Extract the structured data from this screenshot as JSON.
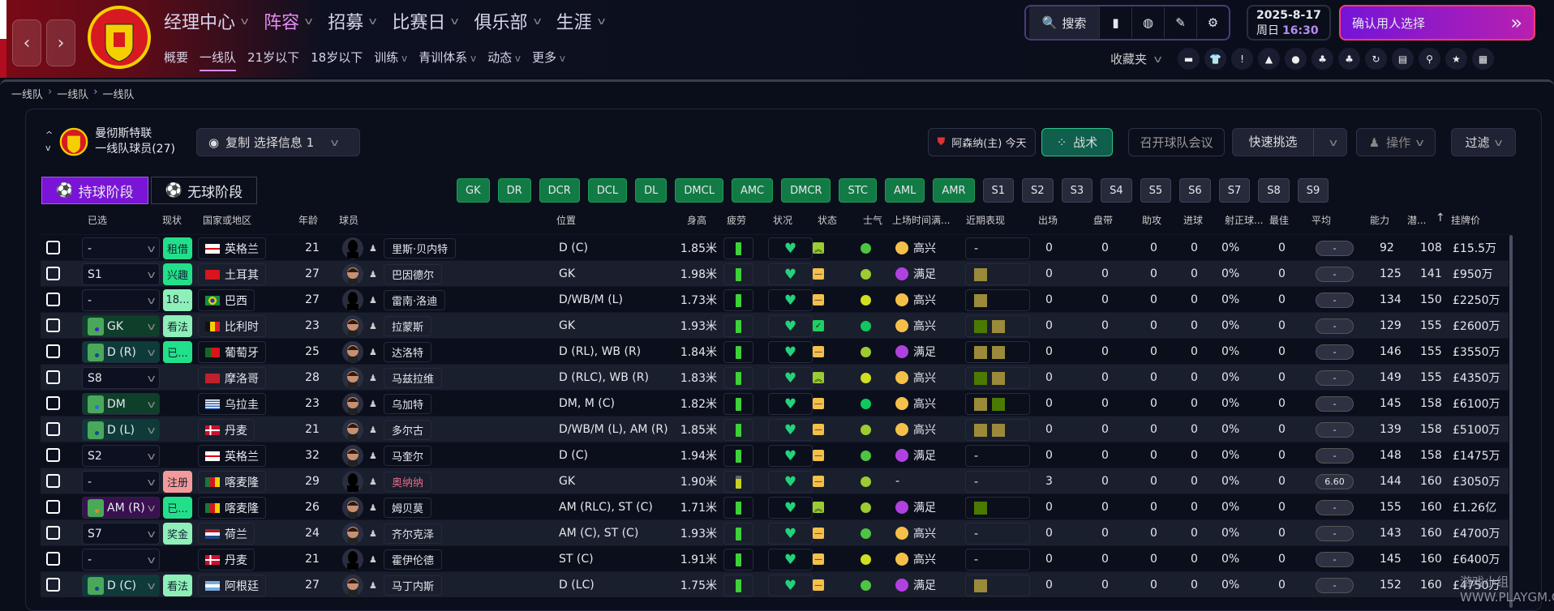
{
  "header": {
    "nav": [
      "经理中心",
      "阵容",
      "招募",
      "比赛日",
      "俱乐部",
      "生涯"
    ],
    "nav_active": 1,
    "subnav": [
      "概要",
      "一线队",
      "21岁以下",
      "18岁以下",
      "训练",
      "青训体系",
      "动态",
      "更多"
    ],
    "subnav_dropdown": [
      4,
      5,
      6,
      7
    ],
    "subnav_active": 1,
    "search": "搜索",
    "date": "2025-8-17",
    "weekday": "周日",
    "time": "16:30",
    "confirm": "确认用人选择",
    "favorites": "收藏夹",
    "toolbar_icons": [
      "chat-icon",
      "shirt-icon",
      "alert-icon",
      "cone-icon",
      "ball-icon",
      "staff-icon",
      "staff-star-icon",
      "refresh-icon",
      "report-icon",
      "scout-icon",
      "star-search-icon",
      "calendar-icon"
    ],
    "accent": "#b68cf0"
  },
  "breadcrumb": [
    "一线队",
    "一线队",
    "一线队"
  ],
  "team": {
    "name": "曼彻斯特联",
    "squad": "一线队球员(27)",
    "copy": "复制 选择信息 1",
    "opponent": "阿森纳(主) 今天",
    "tactics": "战术",
    "meeting": "召开球队会议",
    "quick": "快速挑选",
    "ops": "操作",
    "filter": "过滤"
  },
  "phases": [
    "持球阶段",
    "无球阶段"
  ],
  "positions": [
    "GK",
    "DR",
    "DCR",
    "DCL",
    "DL",
    "DMCL",
    "AMC",
    "DMCR",
    "STC",
    "AML",
    "AMR"
  ],
  "slots": [
    "S1",
    "S2",
    "S3",
    "S4",
    "S5",
    "S6",
    "S7",
    "S8",
    "S9"
  ],
  "columns": [
    "已选",
    "现状",
    "国家或地区",
    "年龄",
    "球员",
    "位置",
    "身高",
    "疲劳",
    "状况",
    "状态",
    "士气",
    "上场时间满...",
    "近期表现",
    "出场",
    "盘带",
    "助攻",
    "进球",
    "射正球...",
    "最佳",
    "平均",
    "能力",
    "潜...",
    "挂牌价"
  ],
  "sort_column": "潜...",
  "players": [
    {
      "sel": "-",
      "pitch": "",
      "badge": "租借",
      "bc": "#22e08a",
      "nat": "英格兰",
      "flag": "eng",
      "age": "21",
      "face": false,
      "name": "里斯·贝内特",
      "pos": "D (C)",
      "h": "1.85米",
      "fat": "full",
      "state": "up",
      "mor": "#4cc640",
      "mood": "高兴",
      "mc": "#f5c04a",
      "form": [],
      "apps": "0",
      "drb": "0",
      "ast": "0",
      "gls": "0",
      "sot": "0%",
      "pom": "0",
      "avg": "-",
      "ca": "92",
      "pa": "108",
      "price": "£15.5万"
    },
    {
      "sel": "S1",
      "pitch": "",
      "badge": "兴趣",
      "bc": "#22e08a",
      "nat": "土耳其",
      "flag": "tur",
      "age": "27",
      "face": true,
      "name": "巴因德尔",
      "pos": "GK",
      "h": "1.98米",
      "fat": "full",
      "state": "mid",
      "mor": "#9ccc30",
      "mood": "满足",
      "mc": "#b040e0",
      "form": [
        "o"
      ],
      "apps": "0",
      "drb": "0",
      "ast": "0",
      "gls": "0",
      "sot": "0%",
      "pom": "0",
      "avg": "-",
      "ca": "125",
      "pa": "141",
      "price": "£950万"
    },
    {
      "sel": "-",
      "pitch": "",
      "badge": "18...",
      "bc": "#8ef0b8",
      "nat": "巴西",
      "flag": "bra",
      "age": "27",
      "face": false,
      "name": "雷南·洛迪",
      "pos": "D/WB/M (L)",
      "h": "1.73米",
      "fat": "full",
      "state": "mid",
      "mor": "#d0e020",
      "mood": "高兴",
      "mc": "#f5c04a",
      "form": [
        "o"
      ],
      "apps": "0",
      "drb": "0",
      "ast": "0",
      "gls": "0",
      "sot": "0%",
      "pom": "0",
      "avg": "-",
      "ca": "134",
      "pa": "150",
      "price": "£2250万"
    },
    {
      "sel": "GK",
      "pitch": "green",
      "dot": "#4a20d0",
      "badge": "看法",
      "bc": "#8ef0b8",
      "nat": "比利时",
      "flag": "bel",
      "age": "23",
      "face": true,
      "name": "拉蒙斯",
      "pos": "GK",
      "h": "1.93米",
      "fat": "full",
      "state": "ok",
      "mor": "#10c860",
      "mood": "高兴",
      "mc": "#f5c04a",
      "form": [
        "g",
        "o"
      ],
      "apps": "0",
      "drb": "0",
      "ast": "0",
      "gls": "0",
      "sot": "0%",
      "pom": "0",
      "avg": "-",
      "ca": "129",
      "pa": "155",
      "price": "£2600万"
    },
    {
      "sel": "D (R)",
      "pitch": "teal",
      "dot": "#104a90",
      "badge": "已...",
      "bc": "#22e08a",
      "nat": "葡萄牙",
      "flag": "por",
      "age": "25",
      "face": true,
      "name": "达洛特",
      "pos": "D (RL), WB (R)",
      "h": "1.84米",
      "fat": "full",
      "state": "mid",
      "mor": "#9ccc30",
      "mood": "满足",
      "mc": "#b040e0",
      "form": [
        "o",
        "o"
      ],
      "apps": "0",
      "drb": "0",
      "ast": "0",
      "gls": "0",
      "sot": "0%",
      "pom": "0",
      "avg": "-",
      "ca": "146",
      "pa": "155",
      "price": "£3550万"
    },
    {
      "sel": "S8",
      "pitch": "",
      "badge": "",
      "nat": "摩洛哥",
      "flag": "mar",
      "age": "28",
      "face": true,
      "name": "马兹拉维",
      "pos": "D (RLC), WB (R)",
      "h": "1.83米",
      "fat": "full",
      "state": "up",
      "mor": "#d0e020",
      "mood": "高兴",
      "mc": "#f5c04a",
      "form": [
        "g",
        "o"
      ],
      "apps": "0",
      "drb": "0",
      "ast": "0",
      "gls": "0",
      "sot": "0%",
      "pom": "0",
      "avg": "-",
      "ca": "149",
      "pa": "155",
      "price": "£4350万"
    },
    {
      "sel": "DM",
      "pitch": "green",
      "dot": "#2a70e0",
      "badge": "",
      "nat": "乌拉圭",
      "flag": "uru",
      "age": "23",
      "face": true,
      "name": "乌加特",
      "pos": "DM, M (C)",
      "h": "1.82米",
      "fat": "full",
      "state": "mid",
      "mor": "#10c860",
      "mood": "高兴",
      "mc": "#f5c04a",
      "form": [
        "o",
        "g"
      ],
      "apps": "0",
      "drb": "0",
      "ast": "0",
      "gls": "0",
      "sot": "0%",
      "pom": "0",
      "avg": "-",
      "ca": "145",
      "pa": "158",
      "price": "£6100万"
    },
    {
      "sel": "D (L)",
      "pitch": "teal",
      "dot": "#104a90",
      "badge": "",
      "nat": "丹麦",
      "flag": "den",
      "age": "21",
      "face": true,
      "name": "多尔古",
      "pos": "D/WB/M (L), AM (R)",
      "h": "1.85米",
      "fat": "full",
      "state": "mid",
      "mor": "#9ccc30",
      "mood": "高兴",
      "mc": "#f5c04a",
      "form": [
        "o",
        "o"
      ],
      "apps": "0",
      "drb": "0",
      "ast": "0",
      "gls": "0",
      "sot": "0%",
      "pom": "0",
      "avg": "-",
      "ca": "139",
      "pa": "158",
      "price": "£5100万"
    },
    {
      "sel": "S2",
      "pitch": "",
      "badge": "",
      "nat": "英格兰",
      "flag": "eng",
      "age": "32",
      "face": true,
      "name": "马奎尔",
      "pos": "D (C)",
      "h": "1.94米",
      "fat": "full",
      "state": "mid",
      "mor": "#4cc640",
      "mood": "满足",
      "mc": "#b040e0",
      "form": [],
      "apps": "0",
      "drb": "0",
      "ast": "0",
      "gls": "0",
      "sot": "0%",
      "pom": "0",
      "avg": "-",
      "ca": "148",
      "pa": "158",
      "price": "£1475万"
    },
    {
      "sel": "-",
      "pitch": "",
      "badge": "注册",
      "bc": "#f59a9a",
      "nat": "喀麦隆",
      "flag": "cmr",
      "age": "29",
      "face": false,
      "name": "奥纳纳",
      "namecolor": "#e06a8a",
      "pos": "GK",
      "h": "1.90米",
      "fat": "part",
      "state": "mid",
      "mor": "#9ccc30",
      "mood": "-",
      "mc": "",
      "form": [],
      "apps": "3",
      "drb": "0",
      "ast": "0",
      "gls": "0",
      "sot": "0%",
      "pom": "0",
      "avg": "6.60",
      "ca": "144",
      "pa": "160",
      "price": "£3050万"
    },
    {
      "sel": "AM (R)",
      "pitch": "purple",
      "dot": "#e08a20",
      "badge": "已...",
      "bc": "#22e08a",
      "nat": "喀麦隆",
      "flag": "cmr",
      "age": "26",
      "face": true,
      "name": "姆贝莫",
      "pos": "AM (RLC), ST (C)",
      "h": "1.71米",
      "fat": "full",
      "state": "up",
      "mor": "#9ccc30",
      "mood": "满足",
      "mc": "#b040e0",
      "form": [
        "g"
      ],
      "apps": "0",
      "drb": "0",
      "ast": "0",
      "gls": "0",
      "sot": "0%",
      "pom": "0",
      "avg": "-",
      "ca": "155",
      "pa": "160",
      "price": "£1.26亿"
    },
    {
      "sel": "S7",
      "pitch": "",
      "badge": "奖金",
      "bc": "#8ef0b8",
      "nat": "荷兰",
      "flag": "ned",
      "age": "24",
      "face": true,
      "name": "齐尔克泽",
      "pos": "AM (C), ST (C)",
      "h": "1.93米",
      "fat": "full",
      "state": "mid",
      "mor": "#4cc640",
      "mood": "高兴",
      "mc": "#f5c04a",
      "form": [],
      "apps": "0",
      "drb": "0",
      "ast": "0",
      "gls": "0",
      "sot": "0%",
      "pom": "0",
      "avg": "-",
      "ca": "143",
      "pa": "160",
      "price": "£4700万"
    },
    {
      "sel": "-",
      "pitch": "",
      "badge": "",
      "nat": "丹麦",
      "flag": "den",
      "age": "21",
      "face": false,
      "name": "霍伊伦德",
      "pos": "ST (C)",
      "h": "1.91米",
      "fat": "full",
      "state": "mid",
      "mor": "#d0e020",
      "mood": "高兴",
      "mc": "#f5c04a",
      "form": [],
      "apps": "0",
      "drb": "0",
      "ast": "0",
      "gls": "0",
      "sot": "0%",
      "pom": "0",
      "avg": "-",
      "ca": "145",
      "pa": "160",
      "price": "£6400万"
    },
    {
      "sel": "D (C)",
      "pitch": "teal",
      "dot": "#104a90",
      "badge": "看法",
      "bc": "#8ef0b8",
      "nat": "阿根廷",
      "flag": "arg",
      "age": "27",
      "face": true,
      "name": "马丁内斯",
      "pos": "D (LC)",
      "h": "1.75米",
      "fat": "full",
      "state": "mid",
      "mor": "#4cc640",
      "mood": "满足",
      "mc": "#b040e0",
      "form": [
        "o"
      ],
      "apps": "0",
      "drb": "0",
      "ast": "0",
      "gls": "0",
      "sot": "0%",
      "pom": "0",
      "avg": "-",
      "ca": "152",
      "pa": "160",
      "price": "£4750万"
    }
  ],
  "watermark": "游戏小组 WWW.PLAYGM.CC"
}
